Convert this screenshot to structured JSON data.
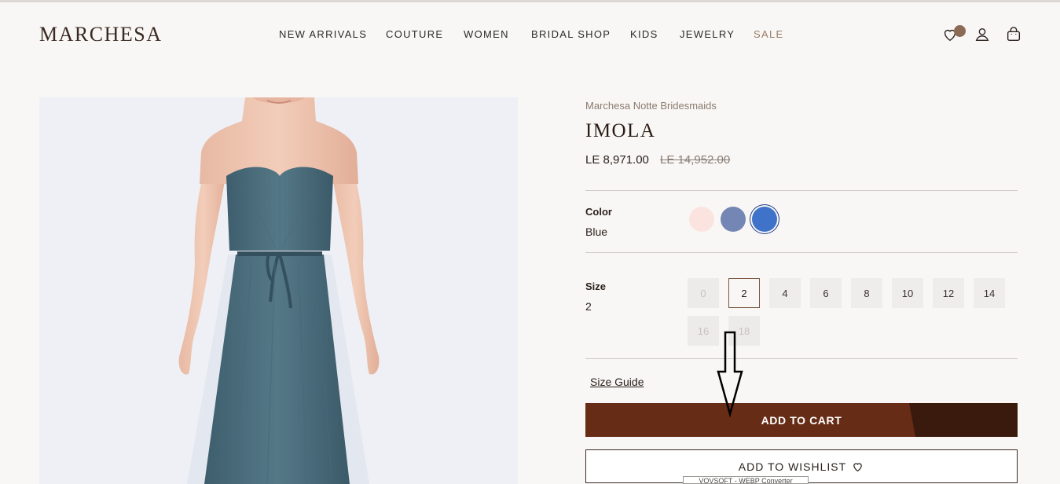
{
  "header": {
    "logo": "MARCHESA",
    "nav": [
      {
        "label": "NEW ARRIVALS"
      },
      {
        "label": "COUTURE"
      },
      {
        "label": "WOMEN"
      },
      {
        "label": "BRIDAL SHOP"
      },
      {
        "label": "KIDS"
      },
      {
        "label": "JEWELRY"
      },
      {
        "label": "SALE"
      }
    ],
    "icons": [
      "heart-icon",
      "user-icon",
      "shopping-bag-icon"
    ]
  },
  "product": {
    "brand_line": "Marchesa Notte Bridesmaids",
    "name": "IMOLA",
    "price": "LE 8,971.00",
    "original_price": "LE 14,952.00",
    "color": {
      "label": "Color",
      "selected": "Blue",
      "swatches": [
        {
          "color": "#fbe3df"
        },
        {
          "color": "#7486b4"
        },
        {
          "color": "#3f73c9",
          "selected": true
        }
      ]
    },
    "size": {
      "label": "Size",
      "selected": "2",
      "options": [
        {
          "value": "0",
          "available": false
        },
        {
          "value": "2",
          "available": true,
          "selected": true
        },
        {
          "value": "4",
          "available": true
        },
        {
          "value": "6",
          "available": true
        },
        {
          "value": "8",
          "available": true
        },
        {
          "value": "10",
          "available": true
        },
        {
          "value": "12",
          "available": true
        },
        {
          "value": "14",
          "available": true
        },
        {
          "value": "16",
          "available": false
        },
        {
          "value": "18",
          "available": false
        }
      ]
    },
    "size_guide_label": "Size Guide",
    "add_to_cart_label": "ADD TO CART",
    "add_to_wishlist_label": "ADD TO WISHLIST"
  },
  "overlay_tag": "VOVSOFT - WEBP Converter",
  "colors": {
    "background": "#f9f7f5",
    "brand_brown": "#672c16",
    "accent": "#9a7b63"
  }
}
